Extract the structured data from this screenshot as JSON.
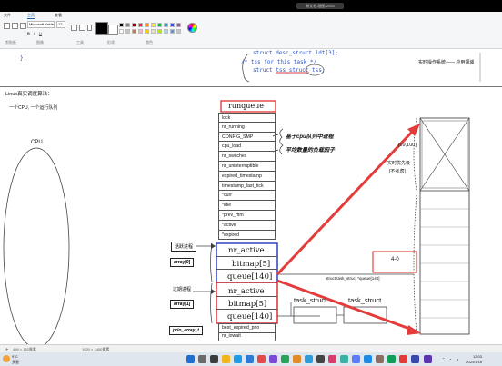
{
  "window": {
    "title": "新文档-画图-2024",
    "tabs": [
      "文件",
      "主页",
      "查看"
    ],
    "active_tab": "主页"
  },
  "ribbon": {
    "font_name": "Microsoft YaHei",
    "font_size": "12",
    "group_labels": [
      "剪贴板",
      "图像",
      "工具",
      "形状",
      "颜色"
    ],
    "palette": [
      "#000000",
      "#7f7f7f",
      "#880015",
      "#ed1c24",
      "#ff7f27",
      "#fff200",
      "#22b14c",
      "#00a2e8",
      "#3f48cc",
      "#a349a4",
      "#ffffff",
      "#c3c3c3",
      "#b97a57",
      "#ffaec9",
      "#ffc90e",
      "#efe4b0",
      "#b5e61d",
      "#99d9ea",
      "#7092be",
      "#c8bfe7"
    ]
  },
  "code": {
    "brace": "};",
    "line1": "struct desc_struct ldt[3];",
    "line2": "/* tss for this task */",
    "line3": "struct tss_struct tss;",
    "note": "实时操作系统—— 应用领域"
  },
  "notes": {
    "heading": "Linux真实调度算法：",
    "one_queue": "一个CPU, 一个运行队列",
    "cpu": "CPU"
  },
  "runqueue": {
    "title": "runqueue",
    "fields": [
      "lock",
      "nr_running",
      "CONFIG_SMP",
      "cpu_load",
      "nr_switches",
      "nr_uninterruptible",
      "expired_timestamp",
      "timestamp_last_tick",
      "*curr",
      "*idle",
      "*prev_mm",
      "*active",
      "*expired"
    ],
    "active_rows": [
      "nr_active",
      "bitmap[5]",
      "queue[140]"
    ],
    "expired_rows": [
      "nr_active",
      "bitmap[5]",
      "queue[140]"
    ],
    "tail_fields": [
      "best_expired_prio",
      "nr_iowait"
    ]
  },
  "labels": {
    "active_process": "活跃进程",
    "expired_process": "过期进程",
    "array0": "array[0]",
    "array1": "array[1]",
    "prio_array": "prio_array_t",
    "bubble_line1": "基于cpu队列中进程",
    "bubble_line2": "平均数量的负载因子"
  },
  "right": {
    "range": "[99,100]",
    "realtime_line1": "实时优先级",
    "realtime_line2": "[不考虑]",
    "task_struct_1": "task_struct",
    "task_struct_2": "task_struct",
    "queue_decl": "struct task_struct *queue[140]",
    "scribble": "4-0"
  },
  "statusbar": {
    "pos": "496 × 152像素",
    "size": "1920 × 1400像素"
  },
  "taskbar": {
    "weather_temp": "9°C",
    "weather_text": "多云",
    "time": "12:03",
    "date": "2024/1/18"
  }
}
